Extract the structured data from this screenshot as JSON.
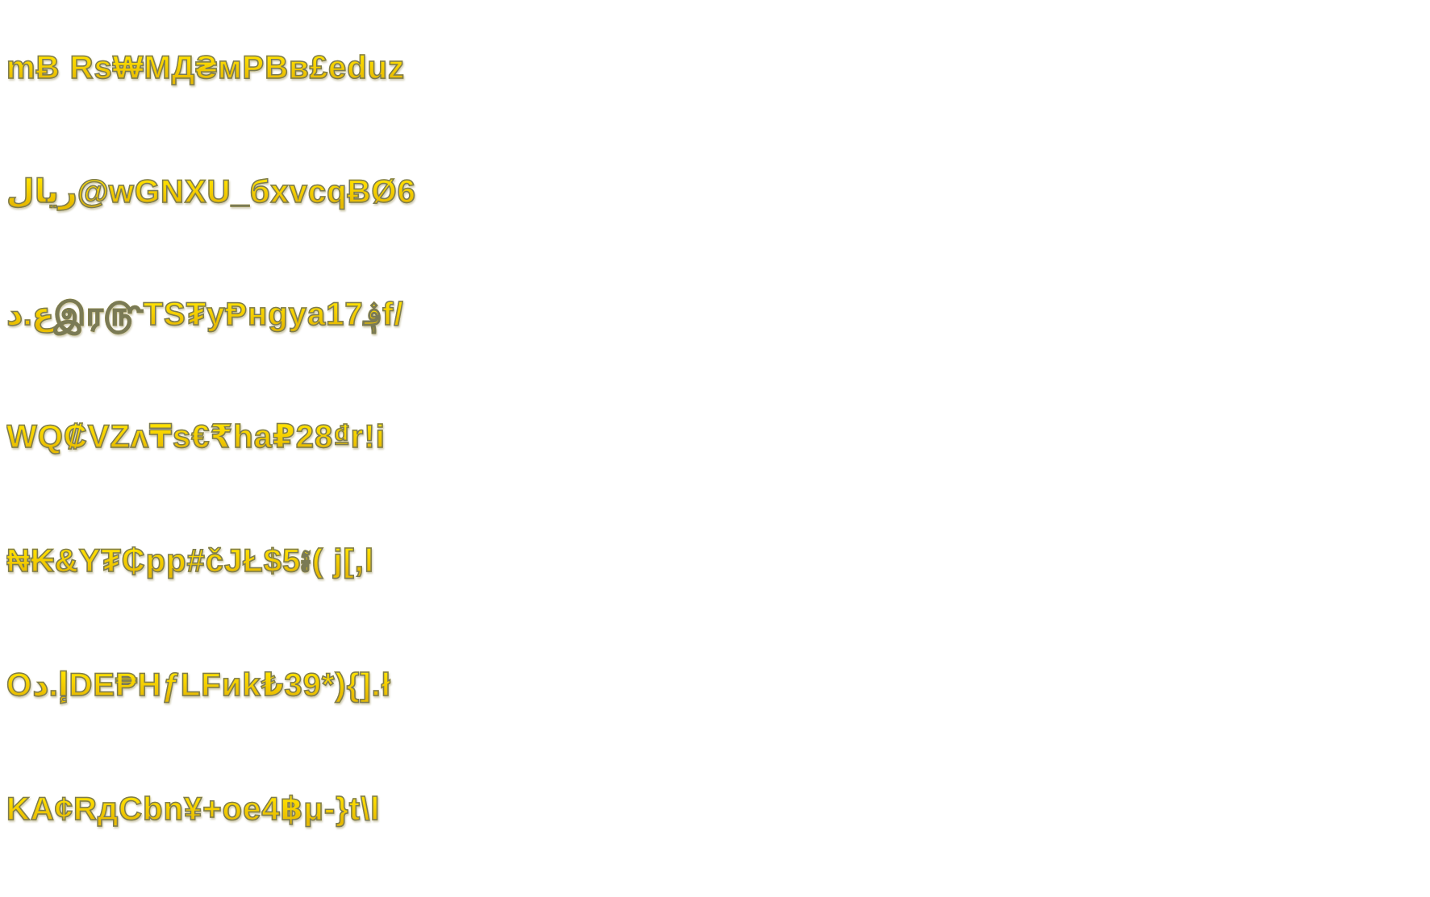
{
  "text_color": "#ffe600",
  "outline_color": "#7a7a55",
  "background_color": "#ffffff",
  "lines": [
    "mɃ Rs₩МД₴мPBв£eduz",
    "ريال@wGNXU_бxvcqɃØ6",
    "ع.دஇர௹TS₮yⱣнgya17؋f/",
    "WQ₡VZʌ₸s€₹ha₽28₫r!i",
    "₦₭&Y₮₵pp#čJŁ$5៛( j[,l",
    "Oإ.دDE₱HƒLFиk₺39*){].ł",
    "KA¢RдCbn¥+oe4฿μ-}t\\l"
  ]
}
